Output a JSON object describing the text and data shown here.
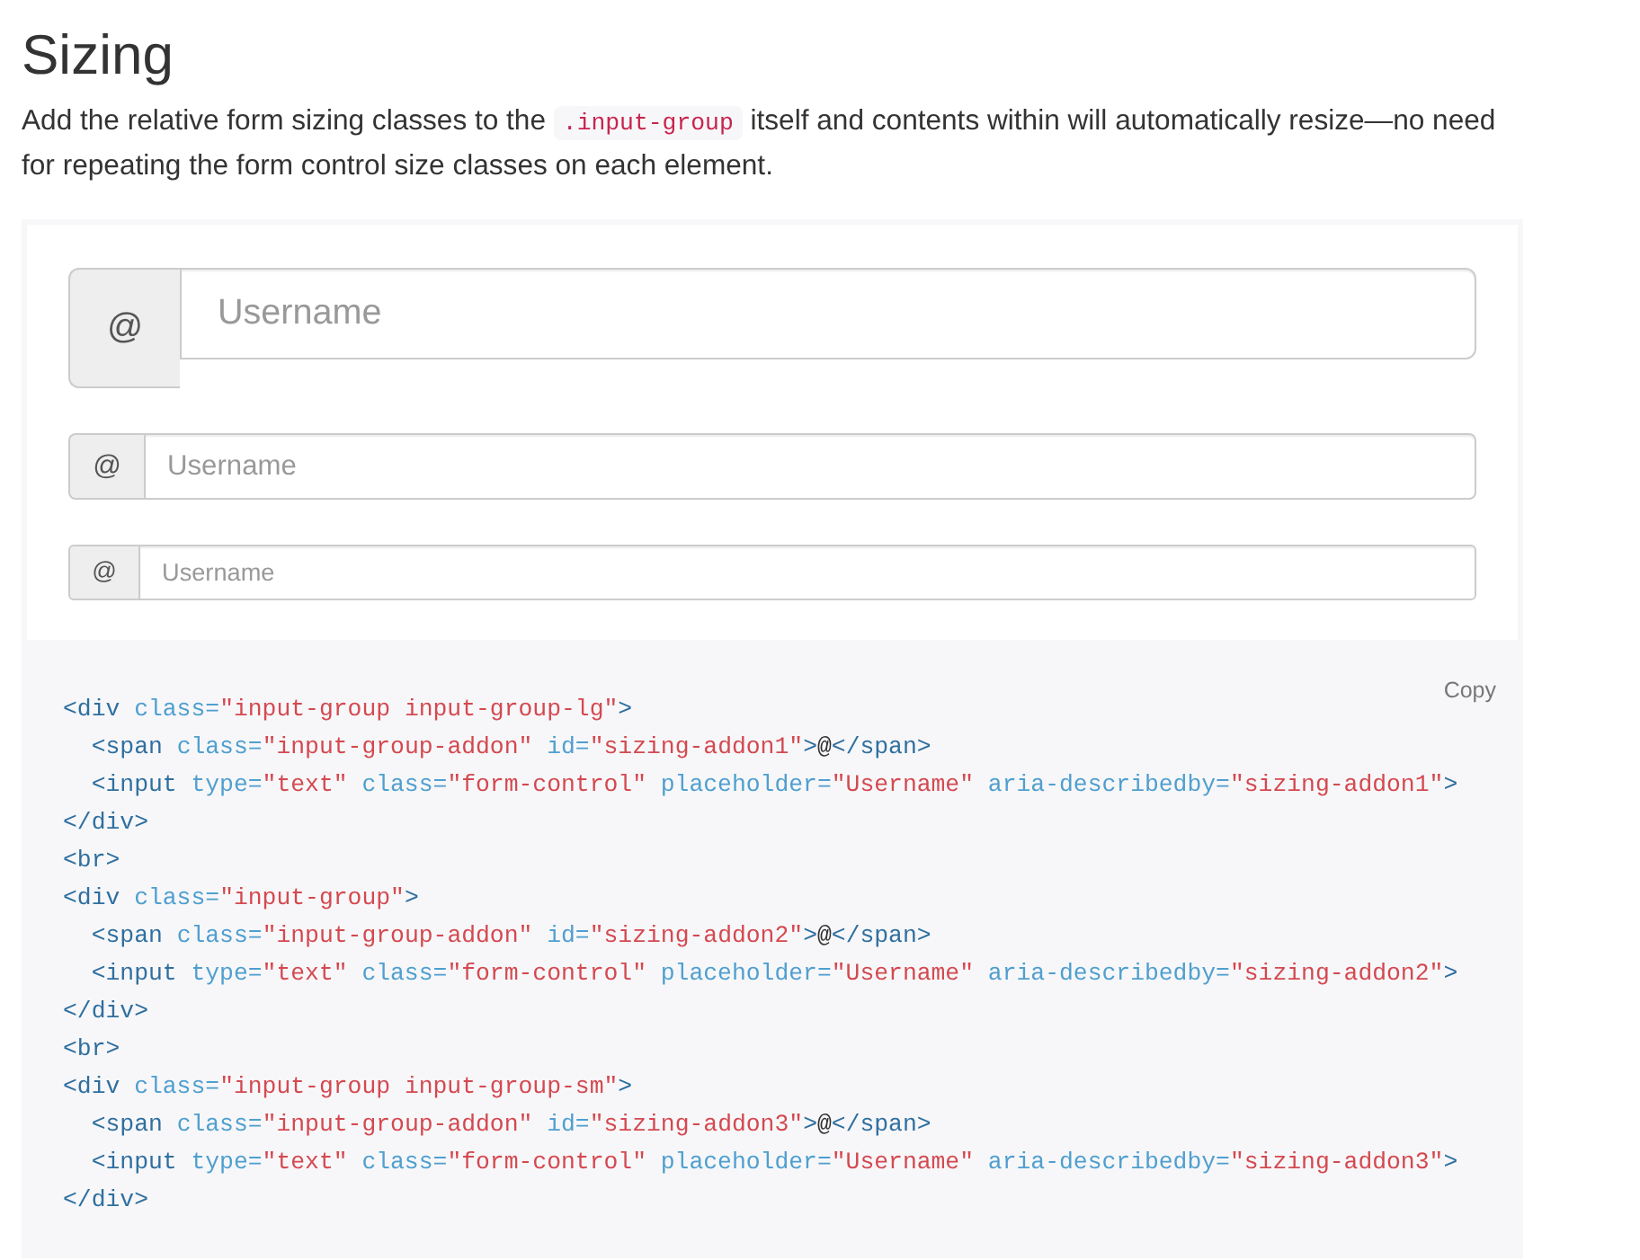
{
  "title": "Sizing",
  "intro": [
    {
      "kind": "text",
      "text": "Add the relative form sizing classes to the "
    },
    {
      "kind": "code",
      "text": ".input-group"
    },
    {
      "kind": "text",
      "text": " itself and contents within will automatically resize—no need for repeating the form control size classes on each element."
    }
  ],
  "example": {
    "input_groups": [
      {
        "kind": "large",
        "addon": "@",
        "placeholder": "Username"
      },
      {
        "kind": "default",
        "addon": "@",
        "placeholder": "Username"
      },
      {
        "kind": "small",
        "addon": "@",
        "placeholder": "Username"
      }
    ]
  },
  "code_block": {
    "copy_label": "Copy",
    "lines": [
      {
        "tokens": [
          {
            "kind": "tag",
            "text": "<div"
          },
          {
            "kind": "attr",
            "text": " class="
          },
          {
            "kind": "string",
            "text": "\"input-group input-group-lg\""
          },
          {
            "kind": "tag",
            "text": ">"
          }
        ]
      },
      {
        "tokens": [
          {
            "kind": "tag",
            "text": "  <span"
          },
          {
            "kind": "attr",
            "text": " class="
          },
          {
            "kind": "string",
            "text": "\"input-group-addon\""
          },
          {
            "kind": "attr",
            "text": " id="
          },
          {
            "kind": "string",
            "text": "\"sizing-addon1\""
          },
          {
            "kind": "tag",
            "text": ">"
          },
          {
            "kind": "text",
            "text": "@"
          },
          {
            "kind": "tag",
            "text": "</span>"
          }
        ]
      },
      {
        "tokens": [
          {
            "kind": "tag",
            "text": "  <input"
          },
          {
            "kind": "attr",
            "text": " type="
          },
          {
            "kind": "string",
            "text": "\"text\""
          },
          {
            "kind": "attr",
            "text": " class="
          },
          {
            "kind": "string",
            "text": "\"form-control\""
          },
          {
            "kind": "attr",
            "text": " placeholder="
          },
          {
            "kind": "string",
            "text": "\"Username\""
          },
          {
            "kind": "attr",
            "text": " aria-describedby="
          },
          {
            "kind": "string",
            "text": "\"sizing-addon1\""
          },
          {
            "kind": "tag",
            "text": ">"
          }
        ]
      },
      {
        "tokens": [
          {
            "kind": "tag",
            "text": "</div>"
          }
        ]
      },
      {
        "tokens": [
          {
            "kind": "tag",
            "text": "<br>"
          }
        ]
      },
      {
        "tokens": [
          {
            "kind": "tag",
            "text": "<div"
          },
          {
            "kind": "attr",
            "text": " class="
          },
          {
            "kind": "string",
            "text": "\"input-group\""
          },
          {
            "kind": "tag",
            "text": ">"
          }
        ]
      },
      {
        "tokens": [
          {
            "kind": "tag",
            "text": "  <span"
          },
          {
            "kind": "attr",
            "text": " class="
          },
          {
            "kind": "string",
            "text": "\"input-group-addon\""
          },
          {
            "kind": "attr",
            "text": " id="
          },
          {
            "kind": "string",
            "text": "\"sizing-addon2\""
          },
          {
            "kind": "tag",
            "text": ">"
          },
          {
            "kind": "text",
            "text": "@"
          },
          {
            "kind": "tag",
            "text": "</span>"
          }
        ]
      },
      {
        "tokens": [
          {
            "kind": "tag",
            "text": "  <input"
          },
          {
            "kind": "attr",
            "text": " type="
          },
          {
            "kind": "string",
            "text": "\"text\""
          },
          {
            "kind": "attr",
            "text": " class="
          },
          {
            "kind": "string",
            "text": "\"form-control\""
          },
          {
            "kind": "attr",
            "text": " placeholder="
          },
          {
            "kind": "string",
            "text": "\"Username\""
          },
          {
            "kind": "attr",
            "text": " aria-describedby="
          },
          {
            "kind": "string",
            "text": "\"sizing-addon2\""
          },
          {
            "kind": "tag",
            "text": ">"
          }
        ]
      },
      {
        "tokens": [
          {
            "kind": "tag",
            "text": "</div>"
          }
        ]
      },
      {
        "tokens": [
          {
            "kind": "tag",
            "text": "<br>"
          }
        ]
      },
      {
        "tokens": [
          {
            "kind": "tag",
            "text": "<div"
          },
          {
            "kind": "attr",
            "text": " class="
          },
          {
            "kind": "string",
            "text": "\"input-group input-group-sm\""
          },
          {
            "kind": "tag",
            "text": ">"
          }
        ]
      },
      {
        "tokens": [
          {
            "kind": "tag",
            "text": "  <span"
          },
          {
            "kind": "attr",
            "text": " class="
          },
          {
            "kind": "string",
            "text": "\"input-group-addon\""
          },
          {
            "kind": "attr",
            "text": " id="
          },
          {
            "kind": "string",
            "text": "\"sizing-addon3\""
          },
          {
            "kind": "tag",
            "text": ">"
          },
          {
            "kind": "text",
            "text": "@"
          },
          {
            "kind": "tag",
            "text": "</span>"
          }
        ]
      },
      {
        "tokens": [
          {
            "kind": "tag",
            "text": "  <input"
          },
          {
            "kind": "attr",
            "text": " type="
          },
          {
            "kind": "string",
            "text": "\"text\""
          },
          {
            "kind": "attr",
            "text": " class="
          },
          {
            "kind": "string",
            "text": "\"form-control\""
          },
          {
            "kind": "attr",
            "text": " placeholder="
          },
          {
            "kind": "string",
            "text": "\"Username\""
          },
          {
            "kind": "attr",
            "text": " aria-describedby="
          },
          {
            "kind": "string",
            "text": "\"sizing-addon3\""
          },
          {
            "kind": "tag",
            "text": ">"
          }
        ]
      },
      {
        "tokens": [
          {
            "kind": "tag",
            "text": "</div>"
          }
        ]
      }
    ]
  }
}
